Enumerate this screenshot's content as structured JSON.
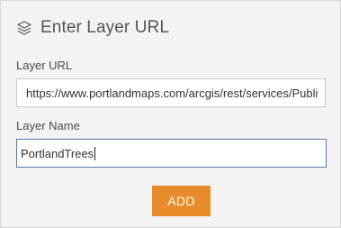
{
  "dialog": {
    "title": "Enter Layer URL",
    "title_icon": "layers-icon"
  },
  "layer_url": {
    "label": "Layer URL",
    "value": "https://www.portlandmaps.com/arcgis/rest/services/Publi"
  },
  "layer_name": {
    "label": "Layer Name",
    "value": "PortlandTrees"
  },
  "actions": {
    "add_label": "ADD"
  },
  "colors": {
    "panel_background": "#f3f3f3",
    "add_button": "#e88b2a",
    "focused_border": "#5a7ba8"
  }
}
